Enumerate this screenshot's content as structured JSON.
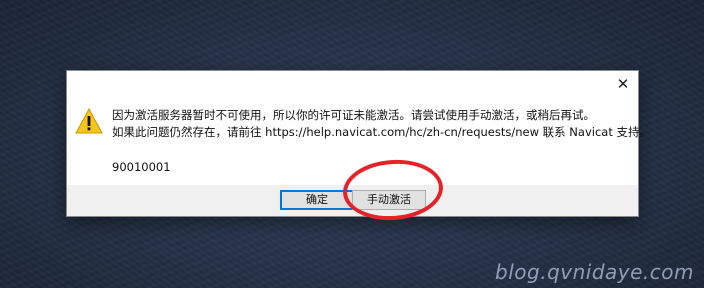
{
  "dialog": {
    "close_glyph": "✕",
    "icon": "warning-icon",
    "message_line1": "因为激活服务器暂时不可使用，所以你的许可证未能激活。请尝试使用手动激活，或稍后再试。",
    "message_line2": "如果此问题仍然存在，请前往 https://help.navicat.com/hc/zh-cn/requests/new 联系 Navicat 支持。",
    "error_code": "90010001",
    "buttons": {
      "ok_label": "确定",
      "manual_label": "手动激活"
    }
  },
  "annotation": {
    "color": "#e52228",
    "target": "manual-activate-button"
  },
  "watermark": {
    "text": "blog.qvnidaye.com"
  },
  "colors": {
    "accent": "#0078d7",
    "warning": "#f5c518"
  }
}
